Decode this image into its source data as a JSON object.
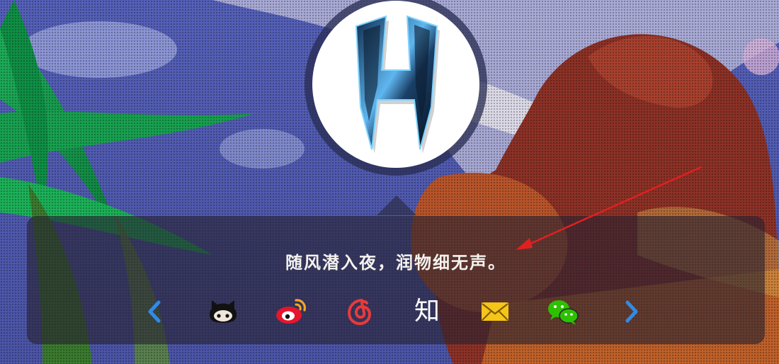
{
  "motto": "随风潜入夜，润物细无声。",
  "social": {
    "prev_icon": "chevron-left-icon",
    "next_icon": "chevron-right-icon",
    "zhihu_text": "知",
    "items": [
      {
        "name": "github",
        "icon": "github-octocat-icon",
        "color": "#111111"
      },
      {
        "name": "weibo",
        "icon": "weibo-icon",
        "color": "#e6162d"
      },
      {
        "name": "netease-music",
        "icon": "netease-music-icon",
        "color": "#e83a3a"
      },
      {
        "name": "zhihu",
        "icon": "zhihu-icon",
        "color": "#ffffff"
      },
      {
        "name": "email",
        "icon": "email-icon",
        "color": "#f5c518"
      },
      {
        "name": "wechat",
        "icon": "wechat-icon",
        "color": "#2dc100"
      }
    ]
  },
  "colors": {
    "chevron": "#2f8be6",
    "annotation_arrow": "#e02020"
  },
  "avatar": {
    "icon": "h-logo-icon"
  }
}
